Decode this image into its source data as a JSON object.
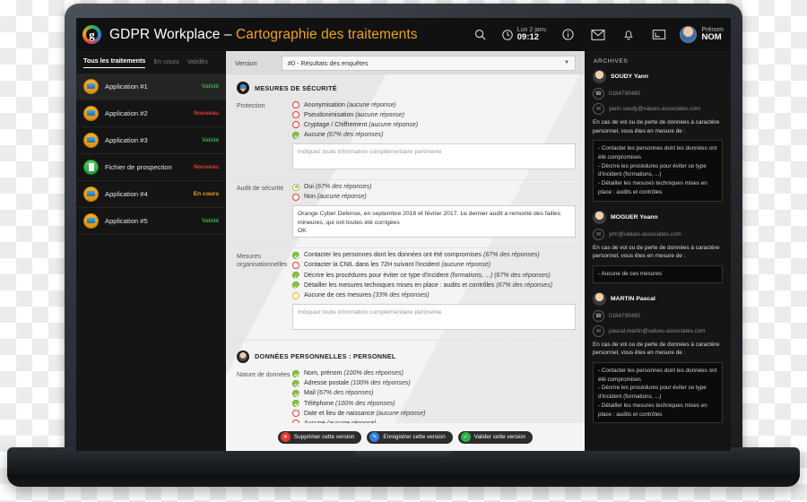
{
  "header": {
    "title_main": "GDPR Workplace – ",
    "title_accent": "Cartographie des traitements",
    "logo_letter": "g",
    "clock_day": "Lun 2 janv.",
    "clock_time": "09:12",
    "user_first": "Prénom",
    "user_last": "NOM",
    "icons": [
      "search-icon",
      "clock-icon",
      "info-icon",
      "mail-icon",
      "bell-icon",
      "screen-icon"
    ]
  },
  "sidebar": {
    "tabs": [
      {
        "label": "Tous les traitements",
        "active": true
      },
      {
        "label": "En cours",
        "active": false
      },
      {
        "label": "Validés",
        "active": false
      }
    ],
    "items": [
      {
        "label": "Application #1",
        "status": "Validé",
        "color": "#3ea84a",
        "icon": "app-icon",
        "active": true
      },
      {
        "label": "Application #2",
        "status": "Nouveau",
        "color": "#e03b2f",
        "icon": "app-icon",
        "active": false
      },
      {
        "label": "Application #3",
        "status": "Validé",
        "color": "#3ea84a",
        "icon": "app-icon",
        "active": false
      },
      {
        "label": "Fichier de prospection",
        "status": "Nouveau",
        "color": "#e03b2f",
        "icon": "doc-icon",
        "active": false
      },
      {
        "label": "Application #4",
        "status": "En cours",
        "color": "#f0a21c",
        "icon": "app-icon",
        "active": false
      },
      {
        "label": "Application #5",
        "status": "Validé",
        "color": "#3ea84a",
        "icon": "app-icon",
        "active": false
      }
    ]
  },
  "main": {
    "version_label": "Version",
    "version_value": "#0 - Résultats des enquêtes",
    "version_caret": "▼",
    "section_security": {
      "title": "MESURES DE SÉCURITÉ",
      "icon": "shield-icon",
      "protection": {
        "label": "Protection",
        "options": [
          {
            "text": "Anonymisation (aucune réponse)",
            "state": "empty-red"
          },
          {
            "text": "Pseudonimisation (aucune réponse)",
            "state": "empty-red"
          },
          {
            "text": "Cryptage / Chiffrement (aucune réponse)",
            "state": "empty-red"
          },
          {
            "text": "Aucune (67% des réponses)",
            "state": "checked-green"
          }
        ],
        "textarea_placeholder": "Indiquez toute information complémentaire pertinente",
        "textarea_value": ""
      },
      "audit": {
        "label": "Audit de sécurité",
        "options": [
          {
            "text": "Oui (67% des réponses)",
            "state": "radio-green"
          },
          {
            "text": "Non (aucune réponse)",
            "state": "empty-red"
          }
        ],
        "textarea_value": "Orange Cyber Defense, en septembre 2016 et février 2017. Le dernier audit a remonté des failles mineures, qui ont toutes été corrigées\nOK"
      },
      "organisationnelles": {
        "label": "Mesures organisationnelles",
        "options": [
          {
            "text": "Contacter les personnes dont les données ont été compromises (67% des réponses)",
            "state": "checked-green"
          },
          {
            "text": "Contacter la CNIL dans les 72H suivant l'incident (aucune réponse)",
            "state": "empty-red"
          },
          {
            "text": "Décrire les procédures pour éviter ce type d'incident (formations, ...) (67% des réponses)",
            "state": "checked-green"
          },
          {
            "text": "Détailler les mesures techniques mises en place : audits et contrôles (67% des réponses)",
            "state": "checked-green"
          },
          {
            "text": "Aucune de ces mesures (33% des réponses)",
            "state": "empty-yellow"
          }
        ],
        "textarea_placeholder": "Indiquez toute information complémentaire pertinente",
        "textarea_value": ""
      }
    },
    "section_personal": {
      "title": "DONNÉES PERSONNELLES : PERSONNEL",
      "icon": "person-icon",
      "nature": {
        "label": "Nature de données",
        "options": [
          {
            "text": "Nom, prénom (100% des réponses)",
            "state": "checked-green"
          },
          {
            "text": "Adresse postale (100% des réponses)",
            "state": "checked-green"
          },
          {
            "text": "Mail (67% des réponses)",
            "state": "checked-green"
          },
          {
            "text": "Téléphone (100% des réponses)",
            "state": "checked-green"
          },
          {
            "text": "Date et lieu de naissance (aucune réponse)",
            "state": "empty-red"
          },
          {
            "text": "Aucune (aucune réponse)",
            "state": "empty-red"
          }
        ]
      }
    },
    "buttons": [
      {
        "label": "Supprimer cette version",
        "icon": "trash-icon",
        "glyph": "✕",
        "color": "#e03b2f"
      },
      {
        "label": "Enregistrer cette version",
        "icon": "pencil-icon",
        "glyph": "✎",
        "color": "#2f7fe0"
      },
      {
        "label": "Valider cette version",
        "icon": "check-icon",
        "glyph": "✓",
        "color": "#2fae4a"
      }
    ]
  },
  "archives": {
    "title": "ARCHIVES",
    "question": "En cas de vol ou de perte de données à caractère personnel, vous êtes en mesure de :",
    "entries": [
      {
        "name": "SOUDY Yann",
        "phone": "0184790480",
        "email": "yann.soudy@values-associates.com",
        "answer": "- Contacter les personnes dont les données ont été compromises\n- Décrire les procédures pour éviter ce type d'incident (formations, ...)\n- Détailler les mesures techniques mises en place : audits et contrôles"
      },
      {
        "name": "MOGUER Yoann",
        "phone": "",
        "email": "ymr@values-associates.com",
        "answer": "- Aucune de ces mesures"
      },
      {
        "name": "MARTIN Pascal",
        "phone": "0184790480",
        "email": "pascal.martin@values-associates.com",
        "answer": "- Contacter les personnes dont les données ont été compromises\n- Décrire les procédures pour éviter ce type d'incident (formations, ...)\n- Détailler les mesures techniques mises en place : audits et contrôles"
      }
    ],
    "phone_glyph": "☎",
    "mail_glyph": "✉"
  }
}
